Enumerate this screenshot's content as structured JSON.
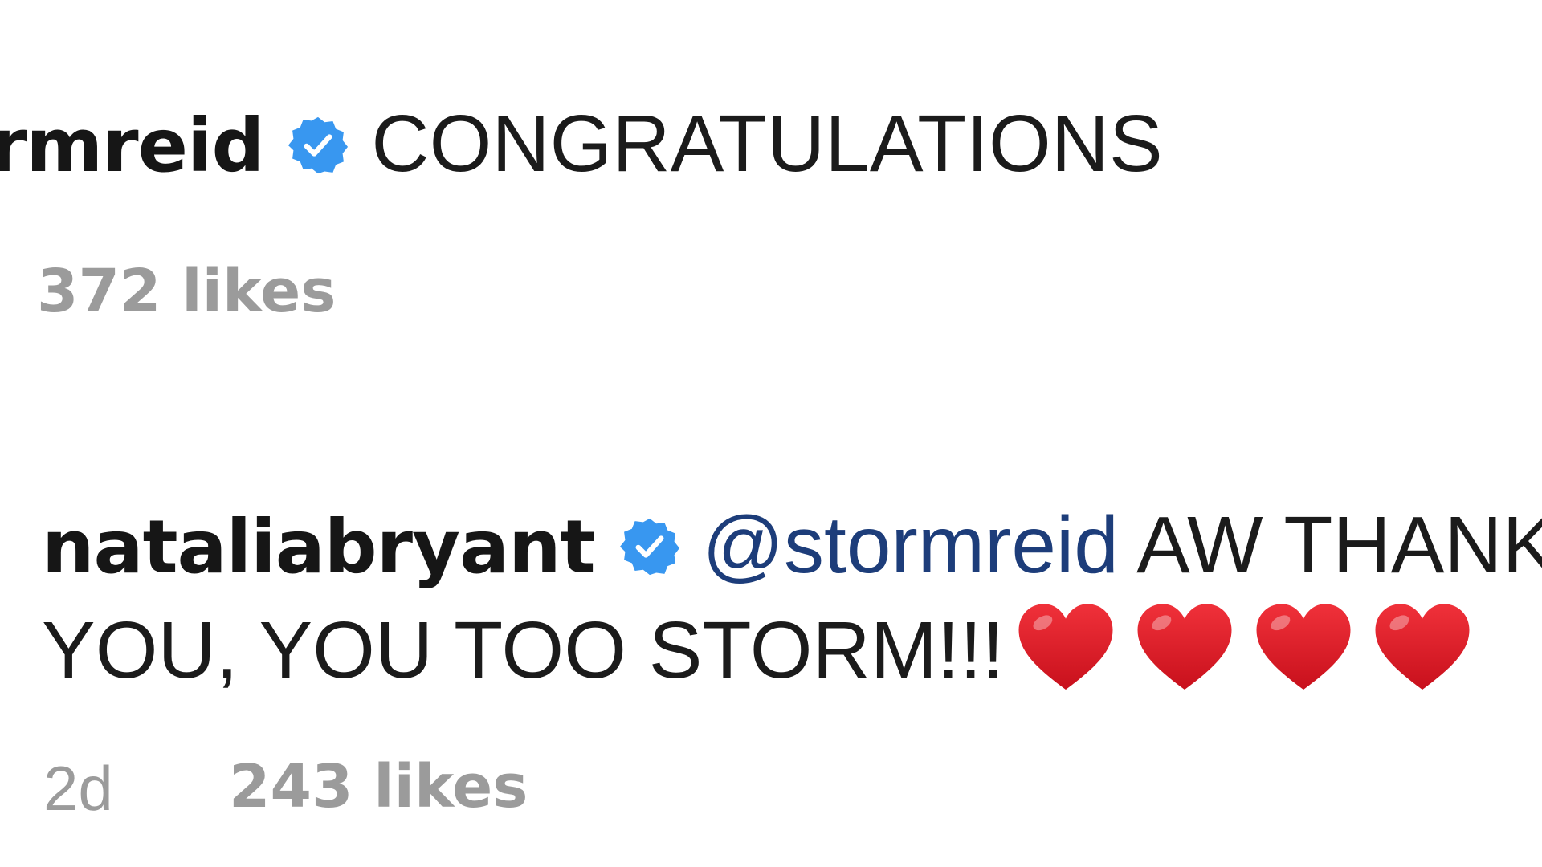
{
  "comments": [
    {
      "username": "rmreid",
      "verified": true,
      "text": "CONGRATULATIONS",
      "likes": "372 likes"
    },
    {
      "username": "nataliabryant",
      "verified": true,
      "mention": "@stormreid",
      "text_line1": "AW THANK",
      "text_line2": "YOU, YOU TOO STORM!!!",
      "emoji": [
        "red-heart",
        "red-heart",
        "red-heart",
        "red-heart"
      ],
      "time": "2d",
      "likes": "243 likes"
    }
  ],
  "colors": {
    "verified_badge": "#3897f0",
    "mention": "#1d3d7a",
    "meta_text": "#9b9b9b",
    "heart": "#e0141f"
  }
}
